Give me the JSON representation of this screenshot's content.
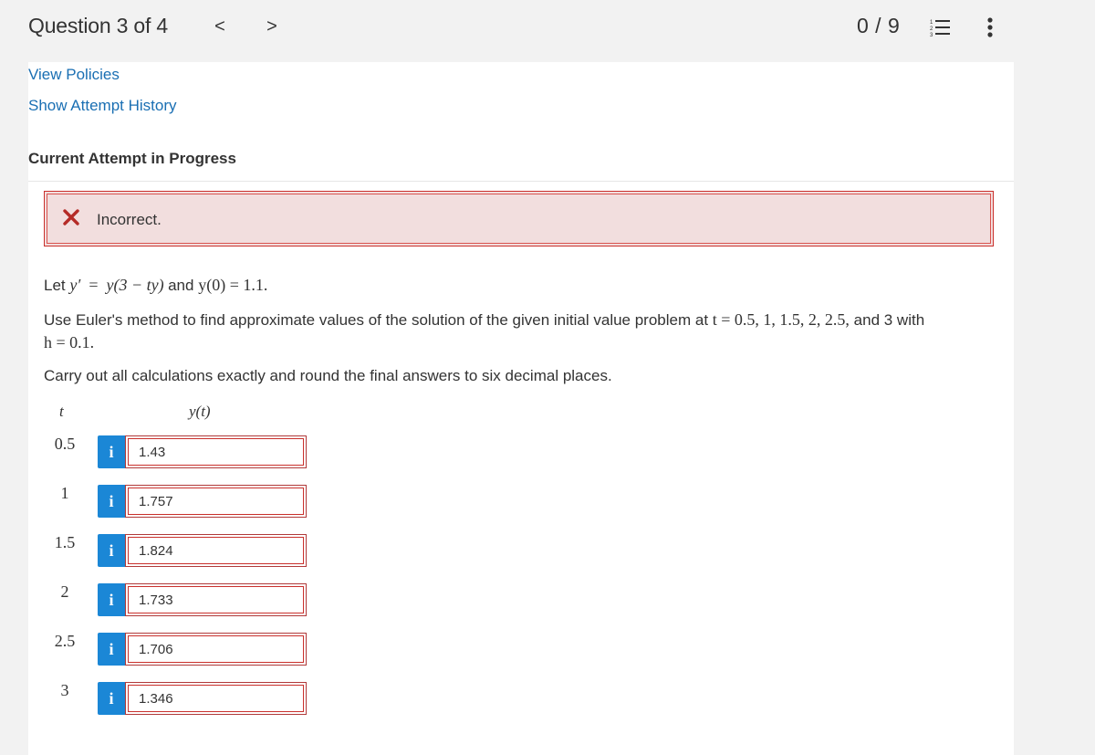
{
  "header": {
    "question_label": "Question 3 of 4",
    "prev": "<",
    "next": ">",
    "score": "0 / 9",
    "list_icon": "numbered-list-icon",
    "more_icon": "vertical-ellipsis-icon"
  },
  "links": {
    "view_policies": "View Policies",
    "attempt_history": "Show Attempt History"
  },
  "section_title": "Current Attempt in Progress",
  "feedback": {
    "status": "Incorrect.",
    "icon": "x-mark-icon",
    "color": "#c9302c",
    "background": "#f2dede"
  },
  "problem": {
    "let_prefix": "Let",
    "equation_lhs": "y′",
    "equation_rhs": "y(3 − ty)",
    "and": "and",
    "initial_condition": "y(0) = 1.1.",
    "instruction_part1": "Use Euler's method to find approximate values of the solution of the given initial value problem at",
    "t_equals": "t = 0.5, 1, 1.5, 2, 2.5,",
    "instruction_part2": "and 3 with",
    "step_size": "h = 0.1.",
    "rounding_note": "Carry out all calculations exactly and round the final answers to six decimal places."
  },
  "table": {
    "col_t": "t",
    "col_y": "y(t)",
    "rows": [
      {
        "t": "0.5",
        "value": "1.43"
      },
      {
        "t": "1",
        "value": "1.757"
      },
      {
        "t": "1.5",
        "value": "1.824"
      },
      {
        "t": "2",
        "value": "1.733"
      },
      {
        "t": "2.5",
        "value": "1.706"
      },
      {
        "t": "3",
        "value": "1.346"
      }
    ],
    "info_glyph": "i",
    "info_color": "#1b87d6",
    "error_border_color": "#c9302c"
  }
}
